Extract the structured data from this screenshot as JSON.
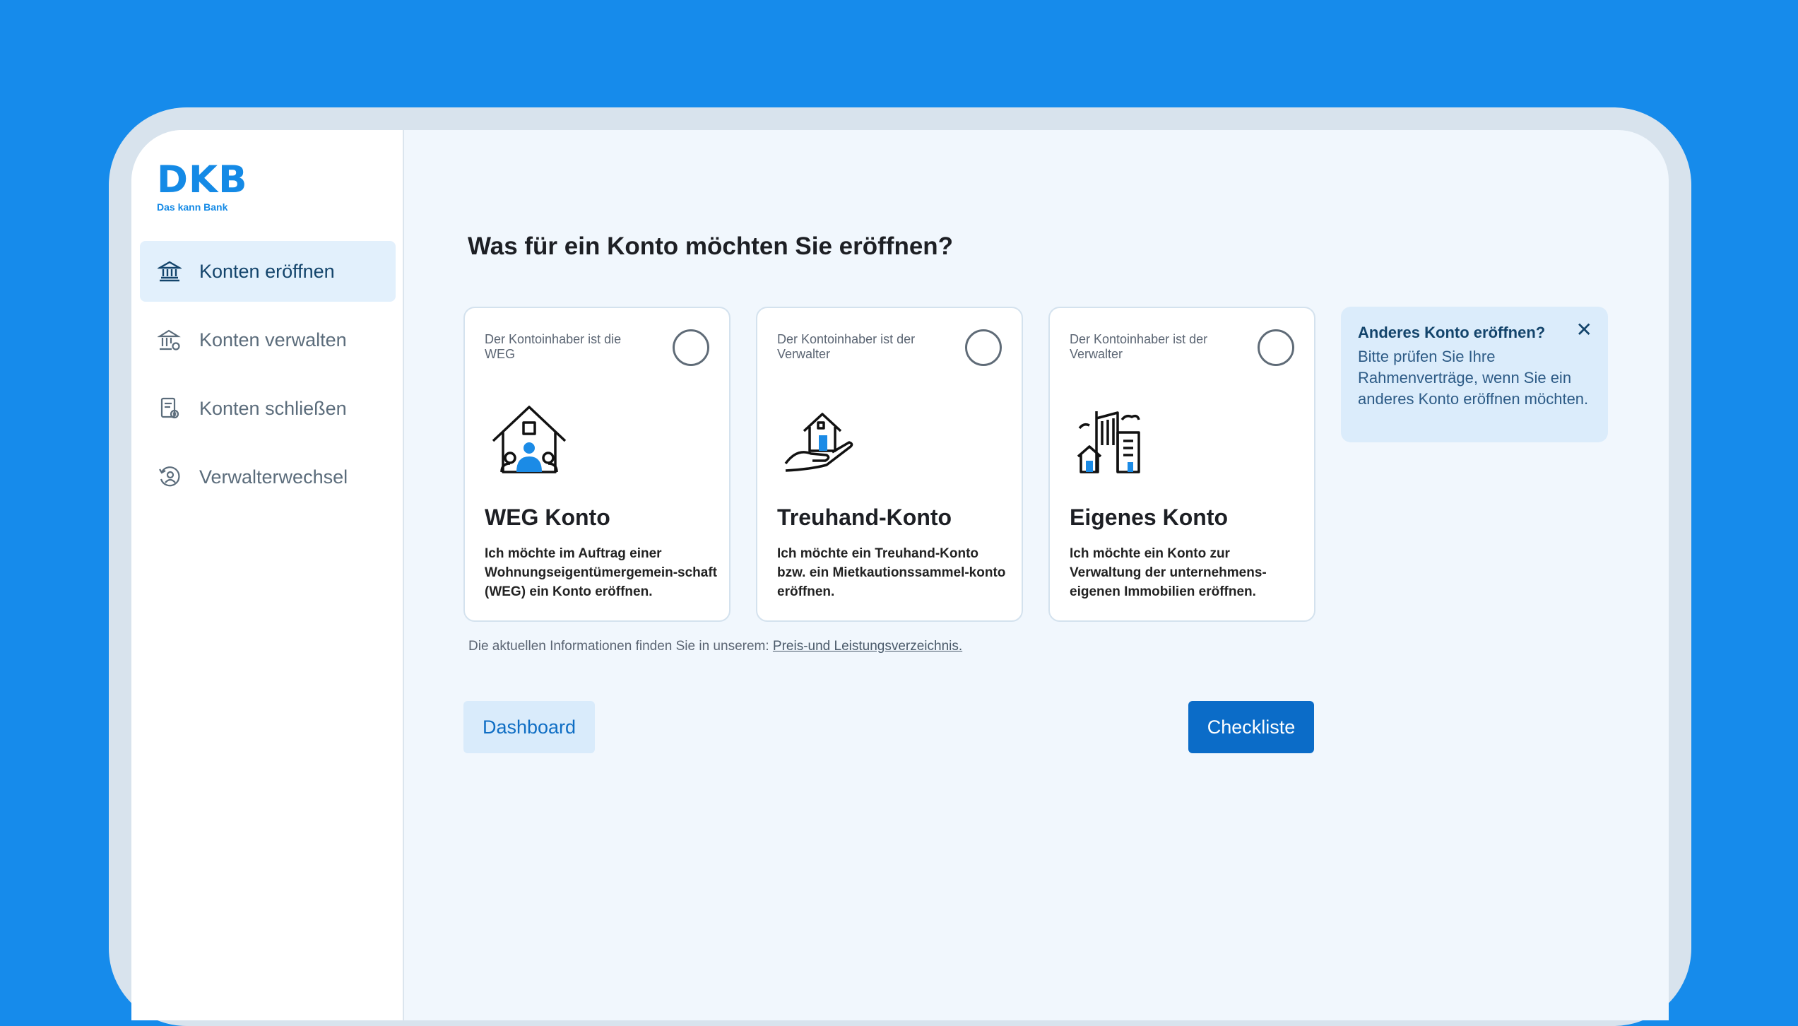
{
  "brand": {
    "logo_text": "DKB",
    "tagline": "Das kann Bank"
  },
  "nav": [
    {
      "label": "Konten eröffnen",
      "icon": "bank-icon",
      "active": true
    },
    {
      "label": "Konten verwalten",
      "icon": "bank-gear-icon",
      "active": false
    },
    {
      "label": "Konten schließen",
      "icon": "document-close-icon",
      "active": false
    },
    {
      "label": "Verwalterwechsel",
      "icon": "user-switch-icon",
      "active": false
    }
  ],
  "main": {
    "title": "Was für ein Konto möchten Sie eröffnen?",
    "cards": [
      {
        "sup": "Der Kontoinhaber ist die WEG",
        "title": "WEG Konto",
        "desc": "Ich möchte im Auftrag einer Wohnungseigentümergemein-schaft (WEG) ein Konto eröffnen.",
        "icon": "house-community-icon"
      },
      {
        "sup": "Der Kontoinhaber ist der Verwalter",
        "title": "Treuhand-Konto",
        "desc": "Ich möchte ein Treuhand-Konto bzw. ein Mietkautionssammel-konto eröffnen.",
        "icon": "house-in-hand-icon"
      },
      {
        "sup": "Der Kontoinhaber ist der Verwalter",
        "title": "Eigenes Konto",
        "desc": "Ich möchte ein Konto zur Verwaltung der unternehmens-eigenen Immobilien eröffnen.",
        "icon": "buildings-icon"
      }
    ],
    "info": {
      "title": "Anderes Konto eröffnen?",
      "text": "Bitte prüfen Sie Ihre Rahmenverträge, wenn Sie ein anderes Konto eröffnen möchten.",
      "close": "✕"
    },
    "footnote": {
      "text": "Die aktuellen Informationen finden Sie in unserem: ",
      "link": "Preis-und Leistungsverzeichnis."
    },
    "buttons": {
      "dashboard": "Dashboard",
      "checklist": "Checkliste"
    }
  },
  "colors": {
    "background": "#168beb",
    "accent": "#0b6cc8",
    "nav_active": "#e2f0fc"
  }
}
